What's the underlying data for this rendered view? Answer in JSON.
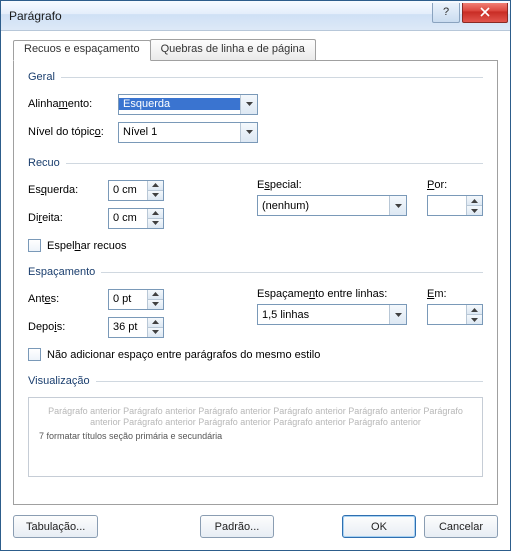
{
  "window": {
    "title": "Parágrafo"
  },
  "tabs": {
    "active": "Recuos e espaçamento",
    "other": "Quebras de linha e de página"
  },
  "general": {
    "header": "Geral",
    "align_label": "Alinhamento:",
    "align_value": "Esquerda",
    "outline_label": "Nível do tópico:",
    "outline_value": "Nível 1"
  },
  "indent": {
    "header": "Recuo",
    "left_label": "Esquerda:",
    "left_value": "0 cm",
    "right_label": "Direita:",
    "right_value": "0 cm",
    "special_label": "Especial:",
    "special_value": "(nenhum)",
    "by_label": "Por:",
    "by_value": "",
    "mirror_label": "Espelhar recuos"
  },
  "spacing": {
    "header": "Espaçamento",
    "before_label": "Antes:",
    "before_value": "0 pt",
    "after_label": "Depois:",
    "after_value": "36 pt",
    "line_label": "Espaçamento entre linhas:",
    "line_value": "1,5 linhas",
    "at_label": "Em:",
    "at_value": "",
    "noadd_label": "Não adicionar espaço entre parágrafos do mesmo estilo"
  },
  "preview": {
    "header": "Visualização",
    "ghost": "Parágrafo anterior Parágrafo anterior Parágrafo anterior Parágrafo anterior Parágrafo anterior Parágrafo anterior Parágrafo anterior Parágrafo anterior Parágrafo anterior Parágrafo anterior",
    "sample": "7 formatar títulos seção primária e secundária"
  },
  "buttons": {
    "tabs": "Tabulação...",
    "default": "Padrão...",
    "ok": "OK",
    "cancel": "Cancelar"
  }
}
